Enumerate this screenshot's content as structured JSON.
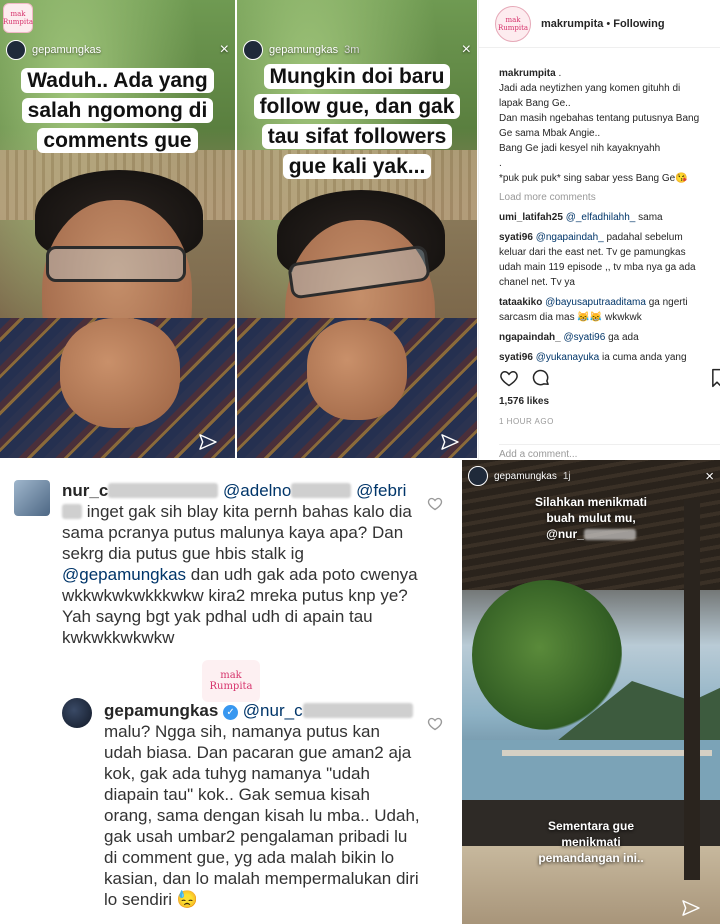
{
  "story_left": {
    "username": "gepamungkas",
    "caption": "Waduh.. Ada yang salah ngomong di comments gue"
  },
  "story_mid": {
    "username": "gepamungkas",
    "time": "3m",
    "caption": "Mungkin doi baru follow gue, dan gak tau sifat followers gue kali yak..."
  },
  "watermark": {
    "line1": "mak",
    "line2": "Rumpita"
  },
  "post": {
    "header_username": "makrumpita",
    "following": "Following",
    "caption_user": "makrumpita",
    "caption_l1": "Jadi ada neytizhen yang komen gituhh di lapak Bang Ge..",
    "caption_l2": "Dan masih ngebahas tentang putusnya Bang Ge sama Mbak Angie..",
    "caption_l3": "Bang Ge jadi kesyel nih kayaknyahh",
    "caption_l4": ".",
    "caption_l5": "*puk puk puk* sing sabar yess Bang Ge😘",
    "load_more": "Load more comments",
    "comments": [
      {
        "user": "umi_latifah25",
        "mention": "@_elfadhilahh_",
        "text": " sama"
      },
      {
        "user": "syati96",
        "mention": "@ngapaindah_",
        "text": " padahal sebelum keluar dari the east net. Tv ge pamungkas udah main 119 episode ,, tv mba nya ga ada chanel net. Tv ya"
      },
      {
        "user": "tataakiko",
        "mention": "@bayusaputraaditama",
        "text": " ga ngerti sarcasm dia mas 😹😹 wkwkwk"
      },
      {
        "user": "ngapaindah_",
        "mention": "@syati96",
        "text": " ga ada"
      },
      {
        "user": "syati96",
        "mention": "@yukanayuka",
        "text": " ia cuma anda yang"
      }
    ],
    "likes": "1,576 likes",
    "time_ago": "1 HOUR AGO",
    "add_comment": "Add a comment..."
  },
  "thread": {
    "c1_user": "nur_c",
    "c1_mention_a": "@adelno",
    "c1_mention_b": "@febri",
    "c1_text_a": " inget gak sih blay kita pernh bahas kalo dia sama pcranya putus malunya kaya apa? Dan sekrg dia putus gue hbis stalk ig ",
    "c1_mention_c": "@gepamungkas",
    "c1_text_b": " dan udh gak ada poto cwenya wkkwkwkwkkkwkw kira2 mreka putus knp ye? Yah sayng bgt yak pdhal udh di apain tau kwkwkkwkwkw",
    "c2_user": "gepamungkas",
    "c2_verified": "✓",
    "c2_mention": "@nur_c",
    "c2_text": " malu? Ngga sih, namanya putus kan udah biasa. Dan pacaran gue aman2 aja kok, gak ada tuhyg namanya \"udah diapain tau\" kok.. Gak semua kisah orang, sama dengan kisah lu mba.. Udah, gak usah umbar2 pengalaman pribadi lu di comment gue, yg ada malah bikin lo kasian, dan lo malah mempermalukan diri lo sendiri 😓"
  },
  "story_right": {
    "username": "gepamungkas",
    "time": "1j",
    "caption_top": "Silahkan menikmati buah mulut mu,",
    "caption_mention": "@nur_",
    "caption_bottom": "Sementara gue menikmati pemandangan ini.."
  },
  "colors": {
    "mention": "#003569",
    "brand_pink": "#d6336c",
    "text": "#262626",
    "muted": "#999999"
  },
  "icons": [
    "close-icon",
    "send-icon",
    "heart-icon",
    "comment-icon",
    "bookmark-icon",
    "verified-icon",
    "heart-outline-icon"
  ]
}
